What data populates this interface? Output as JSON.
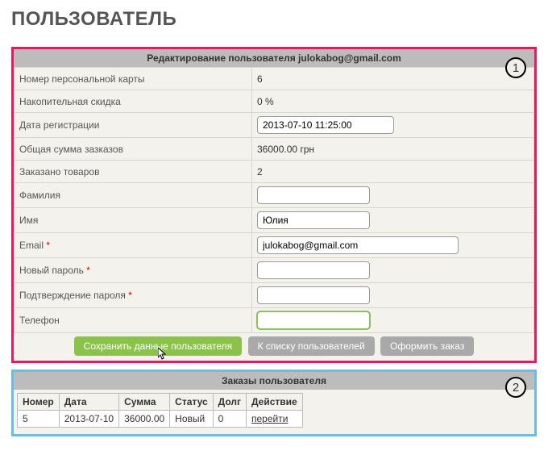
{
  "page_title": "ПОЛЬЗОВАТЕЛЬ",
  "badges": {
    "one": "1",
    "two": "2"
  },
  "edit_panel": {
    "header": "Редактирование пользователя julokabog@gmail.com",
    "rows": {
      "card_label": "Номер персональной карты",
      "card_value": "6",
      "discount_label": "Накопительная скидка",
      "discount_value": "0 %",
      "regdate_label": "Дата регистрации",
      "regdate_value": "2013-07-10 11:25:00",
      "total_label": "Общая сумма зазказов",
      "total_value": "36000.00 грн",
      "ordered_label": "Заказано товаров",
      "ordered_value": "2",
      "lastname_label": "Фамилия",
      "lastname_value": "",
      "firstname_label": "Имя",
      "firstname_value": "Юлия",
      "email_label": "Email",
      "email_value": "julokabog@gmail.com",
      "newpass_label": "Новый пароль",
      "newpass_value": "",
      "confirmpass_label": "Подтверждение пароля",
      "confirmpass_value": "",
      "phone_label": "Телефон",
      "phone_value": ""
    },
    "buttons": {
      "save": "Сохранить данные пользователя",
      "back": "К списку пользователей",
      "order": "Оформить заказ"
    }
  },
  "orders_panel": {
    "header": "Заказы пользователя",
    "columns": {
      "num": "Номер",
      "date": "Дата",
      "sum": "Сумма",
      "status": "Статус",
      "debt": "Долг",
      "action": "Действие"
    },
    "rows": [
      {
        "num": "5",
        "date": "2013-07-10",
        "sum": "36000.00",
        "status": "Новый",
        "debt": "0",
        "action": "перейти"
      }
    ]
  }
}
